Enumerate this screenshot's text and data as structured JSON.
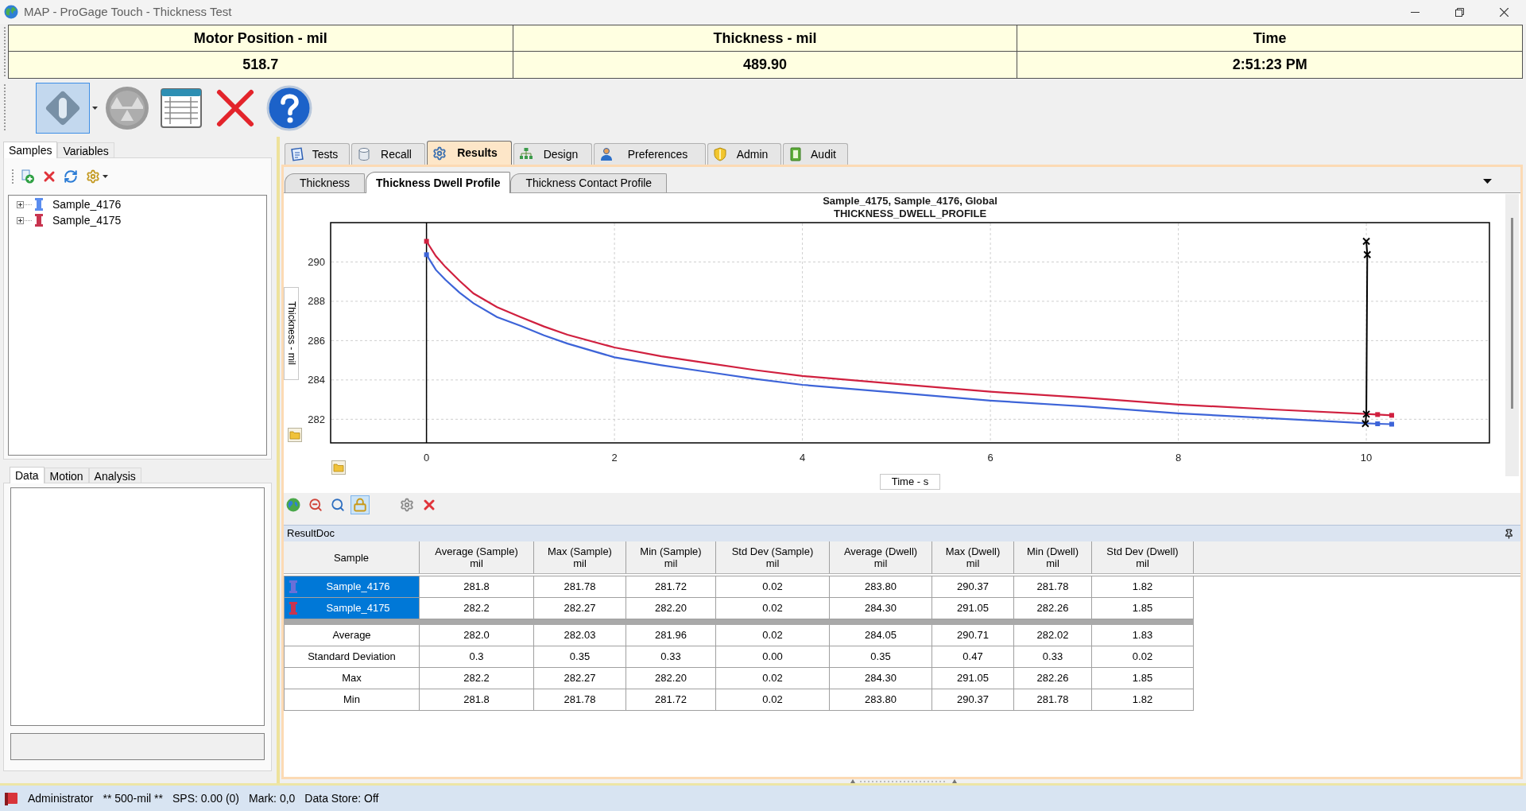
{
  "window": {
    "title": "MAP - ProGage Touch - Thickness Test"
  },
  "readouts": [
    {
      "label": "Motor Position - mil",
      "value": "518.7"
    },
    {
      "label": "Thickness - mil",
      "value": "489.90"
    },
    {
      "label": "Time",
      "value": "2:51:23 PM"
    }
  ],
  "toolbar": [
    {
      "kind": "diamond",
      "active": true,
      "disabled": false,
      "dropdown": true
    },
    {
      "kind": "balance",
      "active": false,
      "disabled": true,
      "dropdown": false
    },
    {
      "kind": "table",
      "active": false,
      "disabled": false,
      "dropdown": false
    },
    {
      "kind": "cancel",
      "active": false,
      "disabled": false,
      "dropdown": false
    },
    {
      "kind": "help",
      "active": false,
      "disabled": false,
      "dropdown": false
    }
  ],
  "sidebar": {
    "tabs": [
      {
        "label": "Samples",
        "selected": true
      },
      {
        "label": "Variables",
        "selected": false
      }
    ],
    "samples": [
      {
        "label": "Sample_4176",
        "color": "#5b8def",
        "expanded": false
      },
      {
        "label": "Sample_4175",
        "color": "#c8344f",
        "expanded": false
      }
    ],
    "detail_tabs": [
      {
        "label": "Data",
        "selected": true
      },
      {
        "label": "Motion",
        "selected": false
      },
      {
        "label": "Analysis",
        "selected": false
      }
    ]
  },
  "main_tabs": [
    {
      "label": "Tests",
      "selected": false
    },
    {
      "label": "Recall",
      "selected": false
    },
    {
      "label": "Results",
      "selected": true
    },
    {
      "label": "Design",
      "selected": false
    },
    {
      "label": "Preferences",
      "selected": false
    },
    {
      "label": "Admin",
      "selected": false
    },
    {
      "label": "Audit",
      "selected": false
    }
  ],
  "view_tabs": [
    {
      "label": "Thickness",
      "selected": false
    },
    {
      "label": "Thickness Dwell Profile",
      "selected": true
    },
    {
      "label": "Thickness Contact Profile",
      "selected": false
    }
  ],
  "chart": {
    "subtitle": "THICKNESS_DWELL_PROFILE",
    "chart_data": {
      "type": "line",
      "title": "Sample_4175, Sample_4176, Global",
      "xlabel": "Time - s",
      "ylabel": "Thickness - mil",
      "x": [
        0,
        0.1,
        0.2,
        0.35,
        0.5,
        0.75,
        1,
        1.25,
        1.5,
        2,
        2.5,
        3,
        3.5,
        4,
        5,
        6,
        7,
        8,
        9,
        10,
        10.12,
        10.27
      ],
      "series": [
        {
          "color": "#d0203f",
          "values": [
            291.05,
            290.3,
            289.75,
            289.05,
            288.4,
            287.7,
            287.2,
            286.72,
            286.3,
            285.65,
            285.2,
            284.85,
            284.5,
            284.2,
            283.8,
            283.4,
            283.1,
            282.75,
            282.5,
            282.27,
            282.24,
            282.2
          ]
        },
        {
          "color": "#3d64d8",
          "values": [
            290.37,
            289.6,
            289.1,
            288.45,
            287.9,
            287.2,
            286.75,
            286.27,
            285.85,
            285.15,
            284.75,
            284.4,
            284.05,
            283.75,
            283.35,
            282.95,
            282.65,
            282.3,
            282.05,
            281.8,
            281.77,
            281.75
          ]
        },
        {
          "color": "#000000",
          "marker": "cross",
          "x": [
            10,
            10.01,
            10,
            9.99
          ],
          "values": [
            291.05,
            290.37,
            282.26,
            281.78
          ]
        }
      ],
      "xlim": [
        -1.02,
        11.31
      ],
      "ylim": [
        280.8,
        292
      ],
      "xticks": [
        0,
        2,
        4,
        6,
        8,
        10
      ],
      "yticks": [
        282,
        284,
        286,
        288,
        290
      ],
      "grid": true,
      "ref_lines": [
        {
          "axis": "x",
          "value": 0,
          "color": "#000000"
        }
      ]
    },
    "tools": [
      {
        "kind": "globe",
        "on": false
      },
      {
        "kind": "zoom-out",
        "on": false
      },
      {
        "kind": "zoom-in",
        "on": false
      },
      {
        "kind": "lock",
        "on": true
      },
      {
        "kind": "settings",
        "on": false
      },
      {
        "kind": "close",
        "on": false
      }
    ]
  },
  "results": {
    "title": "ResultDoc",
    "columns": [
      {
        "name": "Sample"
      },
      {
        "name": "Average (Sample)",
        "unit": "mil"
      },
      {
        "name": "Max (Sample)",
        "unit": "mil"
      },
      {
        "name": "Min (Sample)",
        "unit": "mil"
      },
      {
        "name": "Std Dev (Sample)",
        "unit": "mil"
      },
      {
        "name": "Average (Dwell)",
        "unit": "mil"
      },
      {
        "name": "Max (Dwell)",
        "unit": "mil"
      },
      {
        "name": "Min (Dwell)",
        "unit": "mil"
      },
      {
        "name": "Std Dev (Dwell)",
        "unit": "mil"
      }
    ],
    "sample_rows": [
      {
        "sample": "Sample_4176",
        "color": "#6a6fd8",
        "selected": true,
        "cells": [
          "281.8",
          "281.78",
          "281.72",
          "0.02",
          "283.80",
          "290.37",
          "281.78",
          "1.82"
        ]
      },
      {
        "sample": "Sample_4175",
        "color": "#c8344f",
        "selected": true,
        "cells": [
          "282.2",
          "282.27",
          "282.20",
          "0.02",
          "284.30",
          "291.05",
          "282.26",
          "1.85"
        ]
      }
    ],
    "summary_rows": [
      {
        "label": "Average",
        "cells": [
          "282.0",
          "282.03",
          "281.96",
          "0.02",
          "284.05",
          "290.71",
          "282.02",
          "1.83"
        ]
      },
      {
        "label": "Standard Deviation",
        "cells": [
          "0.3",
          "0.35",
          "0.33",
          "0.00",
          "0.35",
          "0.47",
          "0.33",
          "0.02"
        ]
      },
      {
        "label": "Max",
        "cells": [
          "282.2",
          "282.27",
          "282.20",
          "0.02",
          "284.30",
          "291.05",
          "282.26",
          "1.85"
        ]
      },
      {
        "label": "Min",
        "cells": [
          "281.8",
          "281.78",
          "281.72",
          "0.02",
          "283.80",
          "290.37",
          "281.78",
          "1.82"
        ]
      }
    ]
  },
  "status_bar": [
    "Administrator",
    "** 500-mil **",
    "SPS: 0.00 (0)",
    "Mark: 0,0",
    "Data Store: Off"
  ]
}
